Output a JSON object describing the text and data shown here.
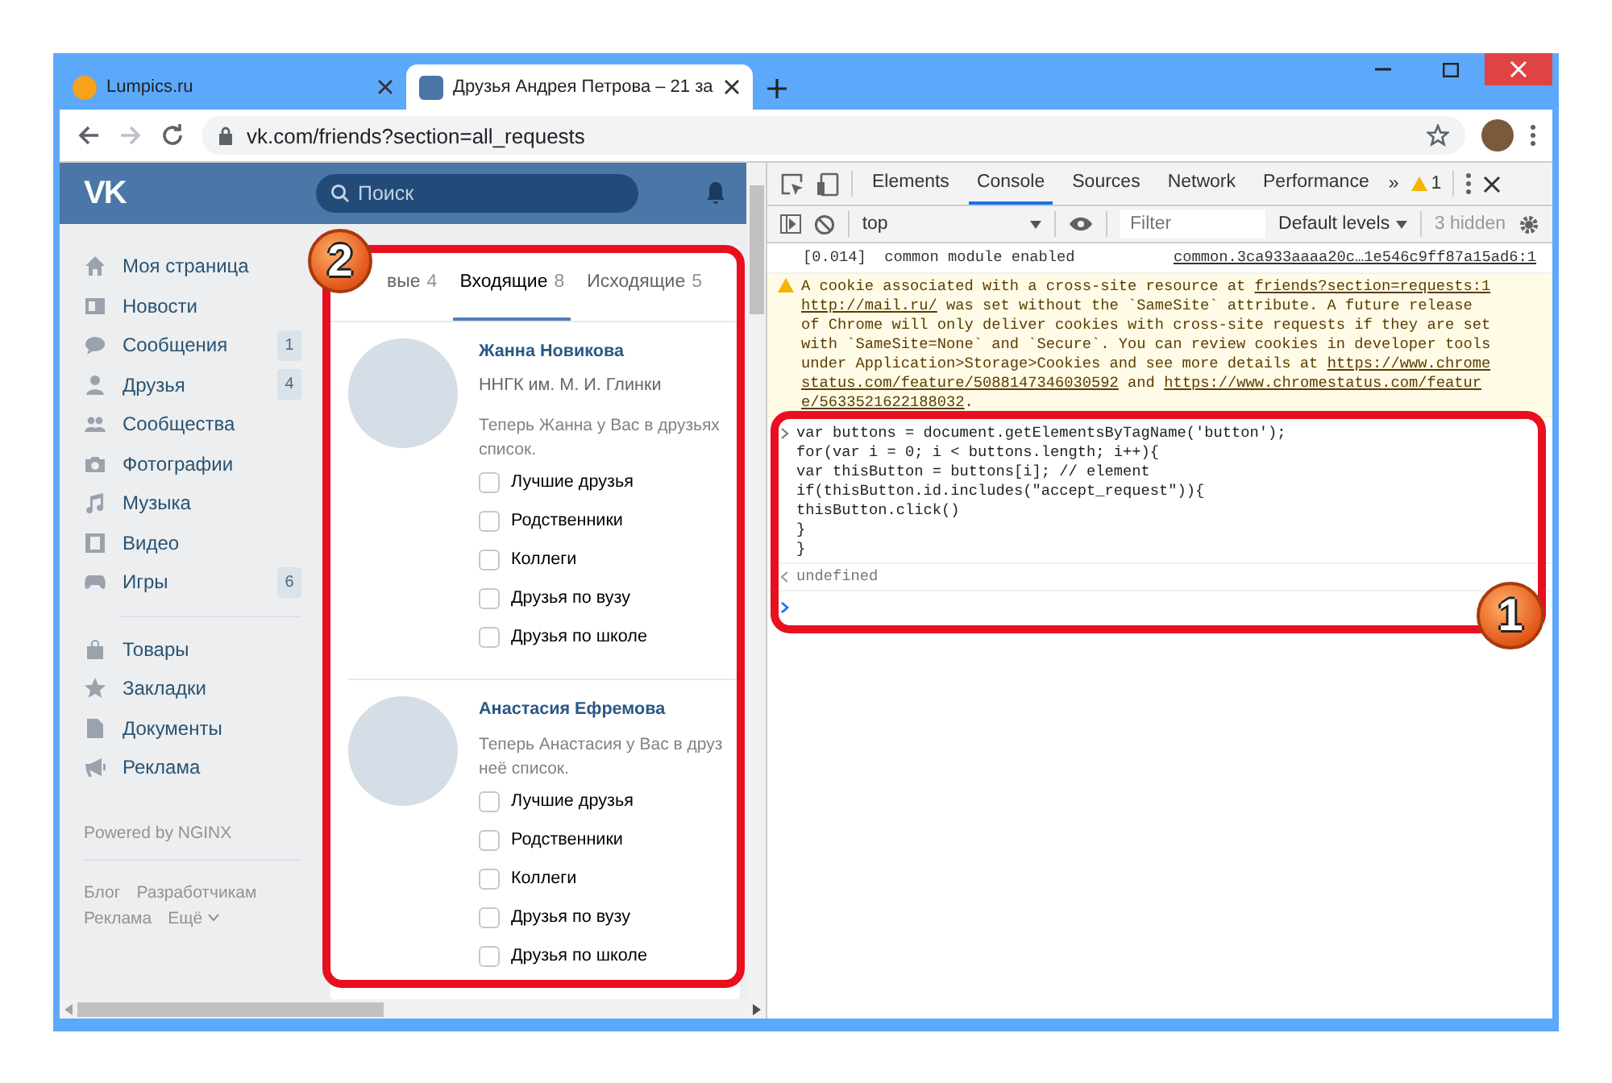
{
  "browser": {
    "tabs": [
      {
        "title": "Lumpics.ru",
        "selected": false
      },
      {
        "title": "Друзья Андрея Петрова – 21 за",
        "selected": true
      }
    ],
    "url": "vk.com/friends?section=all_requests"
  },
  "vk": {
    "logo": "VK",
    "search_placeholder": "Поиск",
    "menu_groups": [
      [
        {
          "label": "Моя страница"
        },
        {
          "label": "Новости"
        },
        {
          "label": "Сообщения",
          "badge": "1"
        },
        {
          "label": "Друзья",
          "badge": "4"
        },
        {
          "label": "Сообщества"
        },
        {
          "label": "Фотографии"
        },
        {
          "label": "Музыка"
        },
        {
          "label": "Видео"
        },
        {
          "label": "Игры",
          "badge": "6"
        }
      ],
      [
        {
          "label": "Товары"
        },
        {
          "label": "Закладки"
        },
        {
          "label": "Документы"
        },
        {
          "label": "Реклама"
        }
      ]
    ],
    "powered": "Powered by NGINX",
    "footer_rows": [
      [
        "Блог",
        "Разработчикам"
      ],
      [
        "Реклама",
        "Ещё"
      ]
    ],
    "request_tabs": [
      {
        "label": "вые",
        "count": "4",
        "selected": false
      },
      {
        "label": "Входящие",
        "count": "8",
        "selected": true
      },
      {
        "label": "Исходящие",
        "count": "5",
        "selected": false
      }
    ],
    "requests": [
      {
        "name": "Жанна Новикова",
        "subtitle": "ННГК им. М. И. Глинки",
        "message_lines": [
          "Теперь Жанна у Вас в друзьях",
          "список."
        ],
        "lists": [
          {
            "label": "Лучшие друзья",
            "checked": false
          },
          {
            "label": "Родственники",
            "checked": false
          },
          {
            "label": "Коллеги",
            "checked": false
          },
          {
            "label": "Друзья по вузу",
            "checked": false
          },
          {
            "label": "Друзья по школе",
            "checked": false
          }
        ]
      },
      {
        "name": "Анастасия Ефремова",
        "message_lines": [
          "Теперь Анастасия у Вас в друз",
          "неё список."
        ],
        "lists": [
          {
            "label": "Лучшие друзья",
            "checked": false
          },
          {
            "label": "Родственники",
            "checked": false
          },
          {
            "label": "Коллеги",
            "checked": false
          },
          {
            "label": "Друзья по вузу",
            "checked": false
          },
          {
            "label": "Друзья по школе",
            "checked": false
          }
        ]
      }
    ]
  },
  "devtools": {
    "tabs": [
      {
        "label": "Elements",
        "selected": false
      },
      {
        "label": "Console",
        "selected": true
      },
      {
        "label": "Sources",
        "selected": false
      },
      {
        "label": "Network",
        "selected": false
      },
      {
        "label": "Performance",
        "selected": false
      }
    ],
    "more": "»",
    "warnings": "1",
    "context": "top",
    "filter_placeholder": "Filter",
    "levels": "Default levels",
    "hidden": "3 hidden",
    "console": {
      "log": {
        "text": "[0.014]  common module enabled",
        "source": "common.3ca933aaaa20c…1e546c9ff87a15ad6:1"
      },
      "warning_lines": [
        [
          {
            "text": "A cookie associated with a cross-site resource at "
          },
          {
            "text": "friends?section=requests:1",
            "link": true
          }
        ],
        [
          {
            "text": "http://mail.ru/",
            "link": true
          },
          {
            "text": " was set without the `SameSite` attribute. A future release"
          }
        ],
        [
          {
            "text": "of Chrome will only deliver cookies with cross-site requests if they are set"
          }
        ],
        [
          {
            "text": "with `SameSite=None` and `Secure`. You can review cookies in developer tools"
          }
        ],
        [
          {
            "text": "under Application>Storage>Cookies and see more details at "
          },
          {
            "text": "https://www.chrome",
            "link": true
          }
        ],
        [
          {
            "text": "status.com/feature/5088147346030592",
            "link": true
          },
          {
            "text": " and "
          },
          {
            "text": "https://www.chromestatus.com/featur",
            "link": true
          }
        ],
        [
          {
            "text": "e/5633521622188032",
            "link": true
          },
          {
            "text": "."
          }
        ]
      ],
      "input_lines": [
        "var buttons = document.getElementsByTagName('button');",
        "for(var i = 0; i < buttons.length; i++){",
        "var thisButton = buttons[i]; // element",
        "if(thisButton.id.includes(\"accept_request\")){",
        "thisButton.click()",
        "}",
        "}"
      ],
      "result": "undefined"
    }
  },
  "callouts": [
    {
      "label": "2"
    },
    {
      "label": "1"
    }
  ]
}
